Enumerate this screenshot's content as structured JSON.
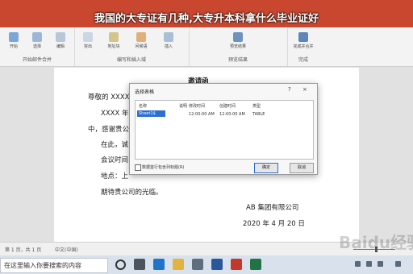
{
  "overlay_title": "我国的大专证有几种,大专升本科拿什么毕业证好",
  "ribbon": {
    "groups": [
      {
        "label": "开始邮件合并",
        "buttons": [
          "开始",
          "选择",
          "编辑"
        ]
      },
      {
        "label": "编写和插入域",
        "buttons": [
          "突出",
          "地址块",
          "问候语",
          "插入"
        ]
      },
      {
        "label": "预览结果",
        "buttons": [
          "预览结果"
        ]
      },
      {
        "label": "完成",
        "buttons": [
          "完成并合并"
        ]
      }
    ]
  },
  "document": {
    "title": "邀请函",
    "salutation": "尊敬的 XXXX",
    "line2": "XXXX 年",
    "line3": "中，感谢贵公",
    "line4": "在此，诚",
    "line5": "会议时间",
    "line6": "地点：上",
    "closing": "期待贵公司的光临。",
    "company": "AB 集团有限公司",
    "date": "2020 年 4 月 20 日"
  },
  "dialog": {
    "title": "选择表格",
    "help": "?",
    "close": "×",
    "columns": [
      "名称",
      "说明",
      "修改时间",
      "创建时间",
      "类型"
    ],
    "row": {
      "name": "Sheet1$",
      "desc": "",
      "modified": "12:00:00 AM",
      "created": "12:00:00 AM",
      "type": "TABLE"
    },
    "checkbox_label": "数据首行包含列标题(R)",
    "ok": "确定",
    "cancel": "取消"
  },
  "statusbar": {
    "page": "第 1 页，共 1 页",
    "lang": "中文(中国)"
  },
  "taskbar": {
    "search_placeholder": "在这里输入你要搜索的内容"
  },
  "watermark": "Baidu经验",
  "colors": {
    "title_bar": "#c9472f",
    "ribbon_bg": "#f3f3f3",
    "selection": "#2c6fd1"
  }
}
